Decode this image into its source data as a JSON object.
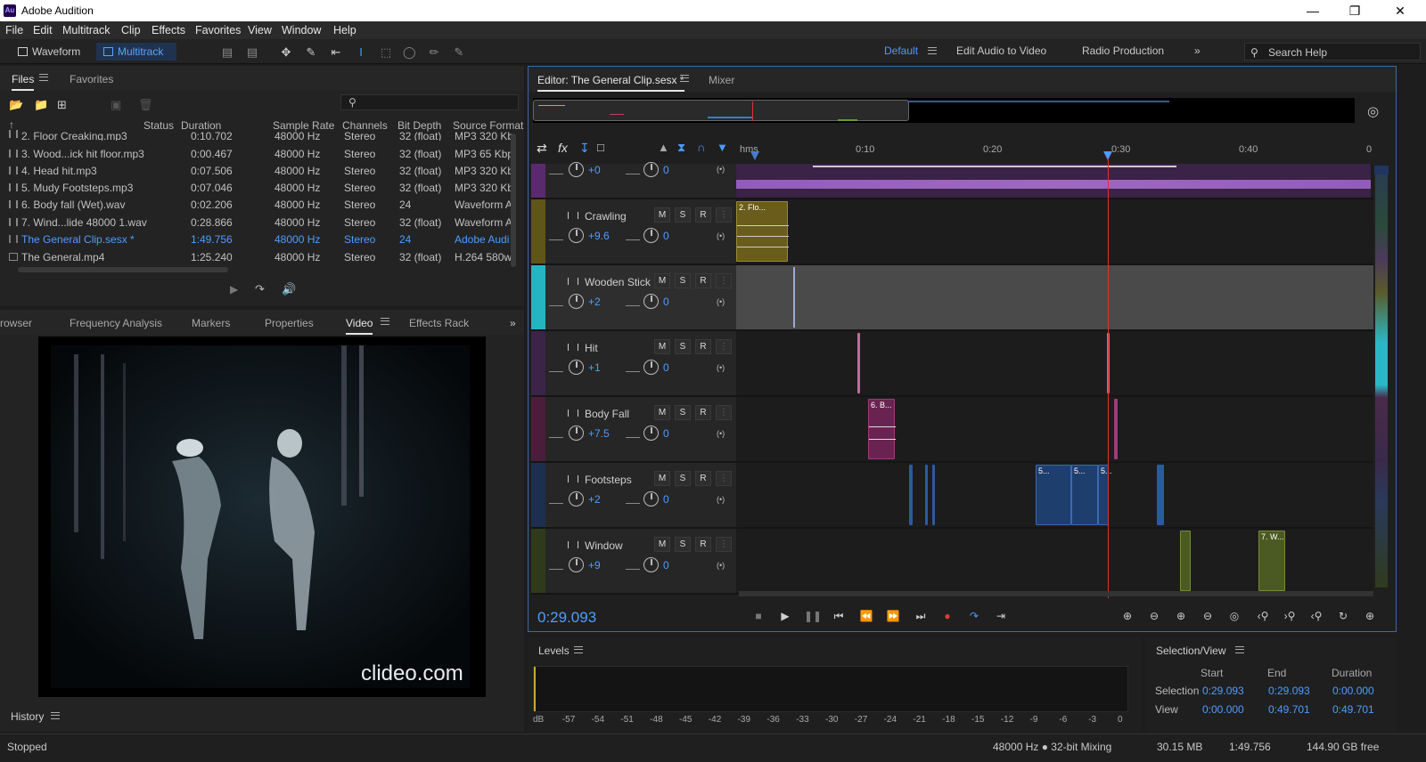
{
  "titlebar": {
    "app_title": "Adobe Audition",
    "logo_text": "Au"
  },
  "menu": [
    "File",
    "Edit",
    "Multitrack",
    "Clip",
    "Effects",
    "Favorites",
    "View",
    "Window",
    "Help"
  ],
  "toolbar": {
    "waveform_label": "Waveform",
    "multitrack_label": "Multitrack"
  },
  "workspaces": {
    "default": "Default",
    "edit_audio_to_video": "Edit Audio to Video",
    "radio_production": "Radio Production"
  },
  "search_help": {
    "placeholder": "Search Help"
  },
  "files_panel": {
    "tabs": [
      "Files",
      "Favorites"
    ],
    "columns": [
      "Status",
      "Duration",
      "Sample Rate",
      "Channels",
      "Bit Depth",
      "Source Format"
    ],
    "rows": [
      {
        "name": "2. Floor Creaking.mp3",
        "duration": "0:10.702",
        "rate": "48000 Hz",
        "channels": "Stereo",
        "depth": "32 (float)",
        "format": "MP3 320 Kb"
      },
      {
        "name": "3. Wood...ick hit floor.mp3",
        "duration": "0:00.467",
        "rate": "48000 Hz",
        "channels": "Stereo",
        "depth": "32 (float)",
        "format": "MP3 65 Kbp"
      },
      {
        "name": "4. Head hit.mp3",
        "duration": "0:07.506",
        "rate": "48000 Hz",
        "channels": "Stereo",
        "depth": "32 (float)",
        "format": "MP3 320 Kb"
      },
      {
        "name": "5. Mudy Footsteps.mp3",
        "duration": "0:07.046",
        "rate": "48000 Hz",
        "channels": "Stereo",
        "depth": "32 (float)",
        "format": "MP3 320 Kb"
      },
      {
        "name": "6. Body fall (Wet).wav",
        "duration": "0:02.206",
        "rate": "48000 Hz",
        "channels": "Stereo",
        "depth": "24",
        "format": "Waveform A"
      },
      {
        "name": "7. Wind...lide 48000 1.wav",
        "duration": "0:28.866",
        "rate": "48000 Hz",
        "channels": "Stereo",
        "depth": "32 (float)",
        "format": "Waveform A"
      },
      {
        "name": "The General Clip.sesx *",
        "duration": "1:49.756",
        "rate": "48000 Hz",
        "channels": "Stereo",
        "depth": "24",
        "format": "Adobe Audi"
      },
      {
        "name": "The General.mp4",
        "duration": "1:25.240",
        "rate": "48000 Hz",
        "channels": "Stereo",
        "depth": "32 (float)",
        "format": "H.264 580w"
      }
    ]
  },
  "mid_tabs": [
    "rowser",
    "Frequency Analysis",
    "Markers",
    "Properties",
    "Video",
    "Effects Rack"
  ],
  "video": {
    "watermark": "clideo.com"
  },
  "history_label": "History",
  "editor": {
    "tab_editor": "Editor: The General Clip.sesx *",
    "tab_mixer": "Mixer"
  },
  "ruler": {
    "labels": [
      "hms",
      "0:10",
      "0:20",
      "0:30",
      "0:40",
      "0"
    ]
  },
  "tracks": [
    {
      "name": "",
      "vol": "+0",
      "pan": "0",
      "color": "#5a2a6e"
    },
    {
      "name": "Crawling",
      "vol": "+9.6",
      "pan": "0",
      "color": "#5f5518"
    },
    {
      "name": "Wooden Stick",
      "vol": "+2",
      "pan": "0",
      "color": "#25b5c0"
    },
    {
      "name": "Hit",
      "vol": "+1",
      "pan": "0",
      "color": "#3b2447"
    },
    {
      "name": "Body Fall",
      "vol": "+7.5",
      "pan": "0",
      "color": "#4a1e3a"
    },
    {
      "name": "Footsteps",
      "vol": "+2",
      "pan": "0",
      "color": "#1c2f4e"
    },
    {
      "name": "Window",
      "vol": "+9",
      "pan": "0",
      "color": "#2f3a1d"
    }
  ],
  "msr": {
    "m": "M",
    "s": "S",
    "r": "R"
  },
  "clip_names": {
    "crawling": "2. Flo...",
    "bodyfall": "6. B...",
    "foot_a": "5...",
    "foot_b": "5...",
    "foot_c": "5...",
    "window": "7. W..."
  },
  "transport": {
    "time": "0:29.093"
  },
  "levels": {
    "label": "Levels",
    "scale": [
      "dB",
      "-57",
      "-54",
      "-51",
      "-48",
      "-45",
      "-42",
      "-39",
      "-36",
      "-33",
      "-30",
      "-27",
      "-24",
      "-21",
      "-18",
      "-15",
      "-12",
      "-9",
      "-6",
      "-3",
      "0"
    ]
  },
  "selection_view": {
    "label": "Selection/View",
    "headers": [
      "Start",
      "End",
      "Duration"
    ],
    "selection_label": "Selection",
    "selection": {
      "start": "0:29.093",
      "end": "0:29.093",
      "duration": "0:00.000"
    },
    "view_label": "View",
    "view": {
      "start": "0:00.000",
      "end": "0:49.701",
      "duration": "0:49.701"
    }
  },
  "status": {
    "state": "Stopped",
    "mixing": "48000 Hz ● 32-bit Mixing",
    "size": "30.15 MB",
    "duration": "1:49.756",
    "free": "144.90 GB free"
  }
}
